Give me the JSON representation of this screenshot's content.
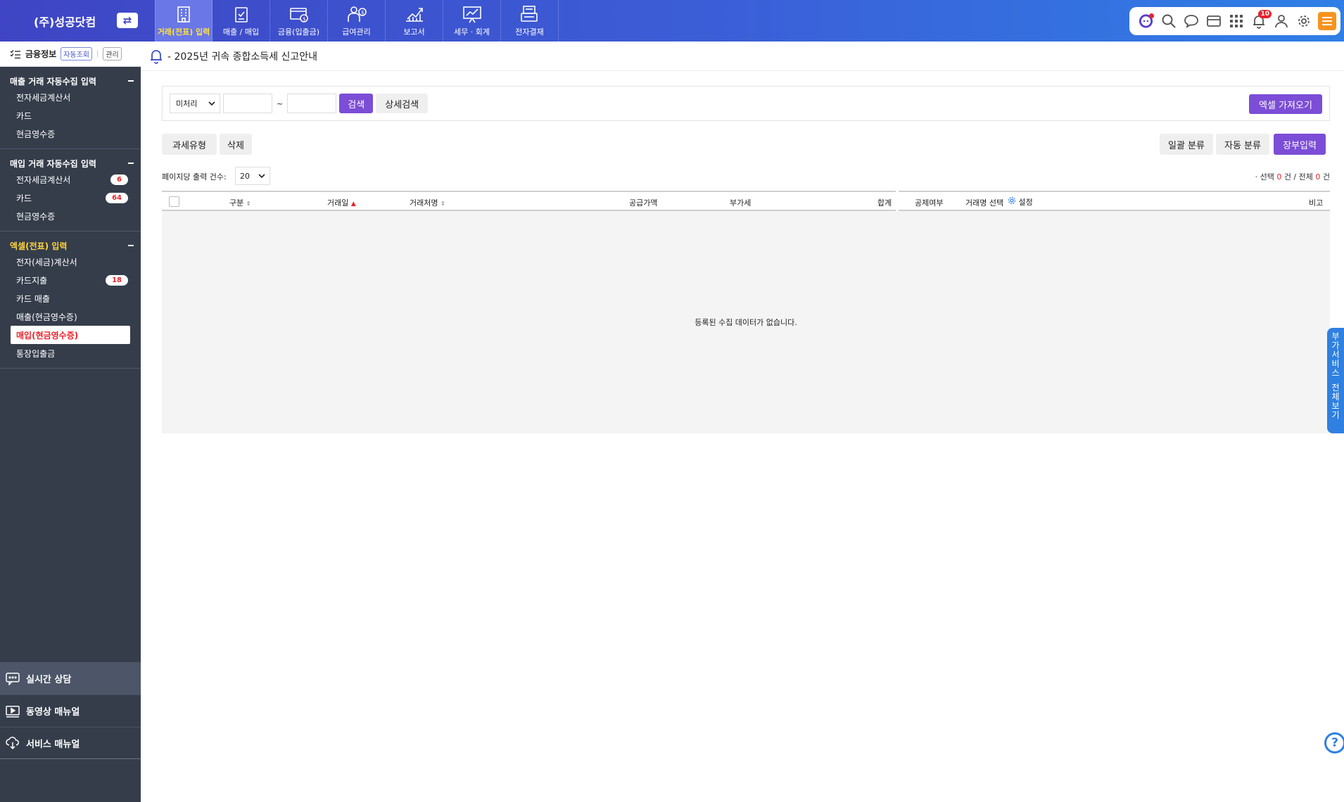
{
  "company": "(주)성공닷컴",
  "nav": [
    {
      "label": "거래(전표) 입력",
      "icon": "building-icon",
      "active": true
    },
    {
      "label": "매출 / 매입",
      "icon": "clipboard-check-icon",
      "active": false
    },
    {
      "label": "금융(입출금)",
      "icon": "card-money-icon",
      "active": false
    },
    {
      "label": "급여관리",
      "icon": "payroll-icon",
      "active": false
    },
    {
      "label": "보고서",
      "icon": "chart-up-icon",
      "active": false
    },
    {
      "label": "세무 · 회계",
      "icon": "presentation-icon",
      "active": false
    },
    {
      "label": "전자결재",
      "icon": "approval-icon",
      "active": false
    }
  ],
  "tools": {
    "notifications_count": "10"
  },
  "sidebar": {
    "title": "금융정보",
    "auto_btn": "자동조회",
    "manage_btn": "관리",
    "sections": [
      {
        "title": "매출 거래 자동수집 입력",
        "items": [
          {
            "label": "전자세금계산서",
            "count": ""
          },
          {
            "label": "카드",
            "count": ""
          },
          {
            "label": "현금영수증",
            "count": ""
          }
        ]
      },
      {
        "title": "매입 거래 자동수집 입력",
        "items": [
          {
            "label": "전자세금계산서",
            "count": "6"
          },
          {
            "label": "카드",
            "count": "64"
          },
          {
            "label": "현금영수증",
            "count": ""
          }
        ]
      },
      {
        "title": "엑셀(전표) 입력",
        "items": [
          {
            "label": "전자(세금)계산서",
            "count": ""
          },
          {
            "label": "카드지출",
            "count": "18"
          },
          {
            "label": "카드 매출",
            "count": ""
          },
          {
            "label": "매출(현금영수증)",
            "count": ""
          },
          {
            "label": "매입(현금영수증)",
            "count": ""
          },
          {
            "label": "통장입출금",
            "count": ""
          }
        ]
      }
    ],
    "bottom": [
      "실시간 상담",
      "동영상 매뉴얼",
      "서비스 매뉴얼"
    ]
  },
  "notice": "- 2025년 귀속 종합소득세 신고안내",
  "filter": {
    "status": "미처리",
    "tilde": "~",
    "search": "검색",
    "detail_search": "상세검색",
    "excel_import": "엑셀 가져오기"
  },
  "toolbar": {
    "tax_type": "과세유형",
    "delete": "삭제",
    "bulk_classify": "일괄 분류",
    "auto_classify": "자동 분류",
    "ledger_input": "장부입력"
  },
  "rows_per_page": {
    "label": "페이지당 출력 건수:",
    "value": "20"
  },
  "summary": {
    "prefix": "· 선택",
    "selected": "0",
    "mid": "건 / 전체",
    "total": "0",
    "suffix": "건"
  },
  "table": {
    "headers": {
      "type": "구분",
      "date": "거래일",
      "vendor": "거래처명",
      "supply": "공급가액",
      "vat": "부가세",
      "total": "합계",
      "deduct": "공제여부",
      "account": "거래명 선택",
      "settings": "설정",
      "memo": "비고"
    },
    "empty": "등록된 수집 데이터가 없습니다."
  },
  "side_tab": [
    "부",
    "가",
    "서",
    "비",
    "스",
    "",
    "전",
    "체",
    "보",
    "기"
  ],
  "help": "?"
}
